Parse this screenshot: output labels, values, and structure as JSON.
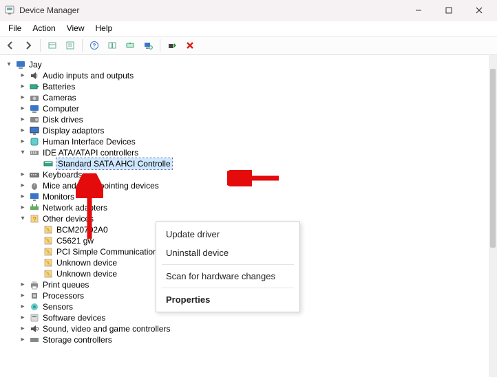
{
  "window": {
    "title": "Device Manager"
  },
  "menu": {
    "items": [
      "File",
      "Action",
      "View",
      "Help"
    ]
  },
  "toolbar": {
    "back": "back-icon",
    "forward": "forward-icon",
    "show_hidden": "show-hidden-icon",
    "properties": "properties-icon",
    "help": "help-icon",
    "refresh": "refresh-icon",
    "update_driver": "update-driver-icon",
    "scan": "scan-icon",
    "add_legacy": "add-legacy-icon",
    "uninstall": "uninstall-icon"
  },
  "tree": {
    "root_label": "Jay",
    "nodes": [
      {
        "label": "Audio inputs and outputs",
        "icon": "audio-icon",
        "expander": "right",
        "level": 1
      },
      {
        "label": "Batteries",
        "icon": "battery-icon",
        "expander": "right",
        "level": 1
      },
      {
        "label": "Cameras",
        "icon": "camera-icon",
        "expander": "right",
        "level": 1
      },
      {
        "label": "Computer",
        "icon": "computer-icon",
        "expander": "right",
        "level": 1
      },
      {
        "label": "Disk drives",
        "icon": "disk-icon",
        "expander": "right",
        "level": 1
      },
      {
        "label": "Display adaptors",
        "icon": "display-icon",
        "expander": "right",
        "level": 1
      },
      {
        "label": "Human Interface Devices",
        "icon": "hid-icon",
        "expander": "right",
        "level": 1
      },
      {
        "label": "IDE ATA/ATAPI controllers",
        "icon": "ide-icon",
        "expander": "down",
        "level": 1
      },
      {
        "label": "Standard SATA AHCI Controlle",
        "icon": "sata-icon",
        "expander": "none",
        "level": 2,
        "selected": true
      },
      {
        "label": "Keyboards",
        "icon": "keyboard-icon",
        "expander": "right",
        "level": 1
      },
      {
        "label": "Mice and other pointing devices",
        "icon": "mouse-icon",
        "expander": "right",
        "level": 1
      },
      {
        "label": "Monitors",
        "icon": "monitor-icon",
        "expander": "right",
        "level": 1
      },
      {
        "label": "Network adapters",
        "icon": "network-icon",
        "expander": "right",
        "level": 1
      },
      {
        "label": "Other devices",
        "icon": "other-icon",
        "expander": "down",
        "level": 1
      },
      {
        "label": "BCM20702A0",
        "icon": "unknown-device-icon",
        "expander": "none",
        "level": 2
      },
      {
        "label": "C5621 gw",
        "icon": "unknown-device-icon",
        "expander": "none",
        "level": 2
      },
      {
        "label": "PCI Simple Communications Controller",
        "icon": "unknown-device-icon",
        "expander": "none",
        "level": 2
      },
      {
        "label": "Unknown device",
        "icon": "unknown-device-icon",
        "expander": "none",
        "level": 2
      },
      {
        "label": "Unknown device",
        "icon": "unknown-device-icon",
        "expander": "none",
        "level": 2
      },
      {
        "label": "Print queues",
        "icon": "printer-icon",
        "expander": "right",
        "level": 1
      },
      {
        "label": "Processors",
        "icon": "cpu-icon",
        "expander": "right",
        "level": 1
      },
      {
        "label": "Sensors",
        "icon": "sensor-icon",
        "expander": "right",
        "level": 1
      },
      {
        "label": "Software devices",
        "icon": "software-icon",
        "expander": "right",
        "level": 1
      },
      {
        "label": "Sound, video and game controllers",
        "icon": "sound-icon",
        "expander": "right",
        "level": 1
      },
      {
        "label": "Storage controllers",
        "icon": "storage-icon",
        "expander": "right",
        "level": 1
      }
    ]
  },
  "context_menu": {
    "items": [
      {
        "label": "Update driver",
        "bold": false
      },
      {
        "label": "Uninstall device",
        "bold": false
      },
      {
        "sep": true
      },
      {
        "label": "Scan for hardware changes",
        "bold": false
      },
      {
        "sep": true
      },
      {
        "label": "Properties",
        "bold": true
      }
    ]
  },
  "annotations": {
    "arrow1_points_to": "Standard SATA AHCI Controller",
    "arrow2_points_to": "Update driver"
  }
}
